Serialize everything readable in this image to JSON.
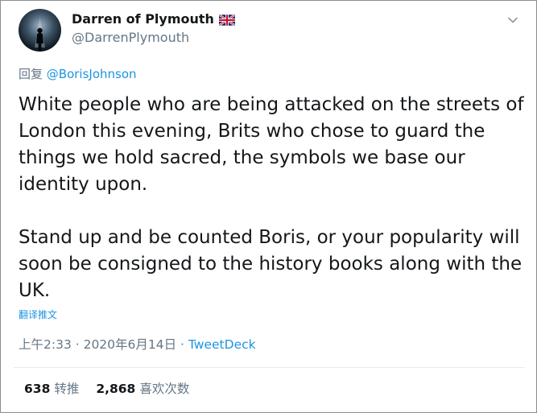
{
  "tweet": {
    "display_name": "Darren of Plymouth",
    "handle": "@DarrenPlymouth",
    "reply_prefix": "回复",
    "reply_to": "@BorisJohnson",
    "paragraphs": [
      "White people who are being attacked on the streets of London this evening, Brits who chose to guard the things we hold sacred, the symbols we base our identity upon.",
      "Stand up and be counted Boris, or your popularity will soon be consigned to the history books along with the UK."
    ],
    "translate_label": "翻译推文",
    "timestamp": "上午2:33 · 2020年6月14日 · ",
    "source": "TweetDeck",
    "retweets_count": "638",
    "retweets_label": "转推",
    "likes_count": "2,868",
    "likes_label": "喜欢次数"
  },
  "icons": {
    "avatar": "avatar-silhouette-icon",
    "flag": "uk-flag-icon",
    "caret": "chevron-down-icon"
  },
  "colors": {
    "link": "#1b95e0",
    "secondary_text": "#657786",
    "primary_text": "#14171a"
  }
}
